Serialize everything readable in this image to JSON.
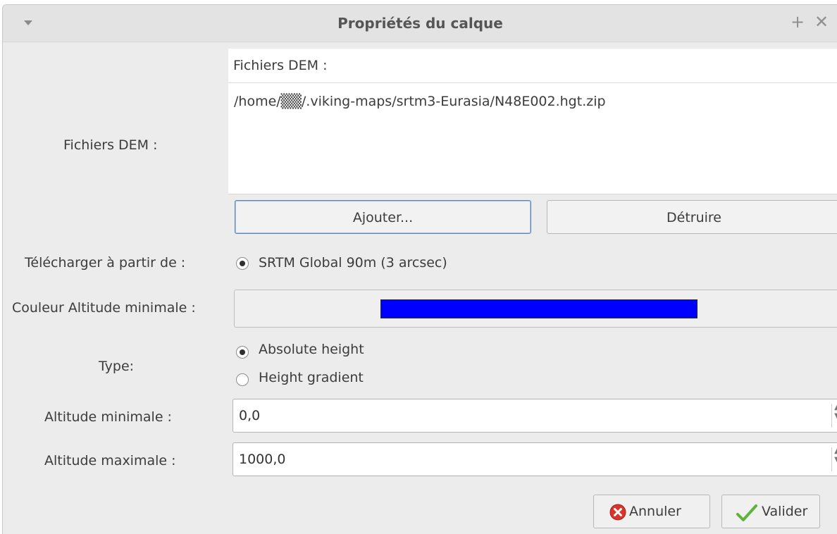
{
  "window": {
    "title": "Propriétés du calque"
  },
  "titlebar": {
    "pin_glyph": "+",
    "close_glyph": "✕"
  },
  "dem_files": {
    "label": "Fichiers DEM :",
    "list_header": "Fichiers DEM :",
    "items": [
      "/home/▒▒/.viking-maps/srtm3-Eurasia/N48E002.hgt.zip"
    ],
    "add_button": "Ajouter...",
    "delete_button": "Détruire"
  },
  "download": {
    "label": "Télécharger à partir de :",
    "option": "SRTM Global 90m (3 arcsec)",
    "selected": true
  },
  "min_color": {
    "label": "Couleur Altitude minimale :",
    "color": "#0000ff"
  },
  "type": {
    "label": "Type:",
    "options": [
      "Absolute height",
      "Height gradient"
    ],
    "selected": "Absolute height"
  },
  "alt_min": {
    "label": "Altitude minimale :",
    "value": "0,0"
  },
  "alt_max": {
    "label": "Altitude maximale :",
    "value": "1000,0"
  },
  "footer": {
    "cancel_label": "Annuler",
    "ok_label": "Valider",
    "cancel_icon_color": "#d9342b",
    "ok_icon_color": "#5fb33c"
  }
}
